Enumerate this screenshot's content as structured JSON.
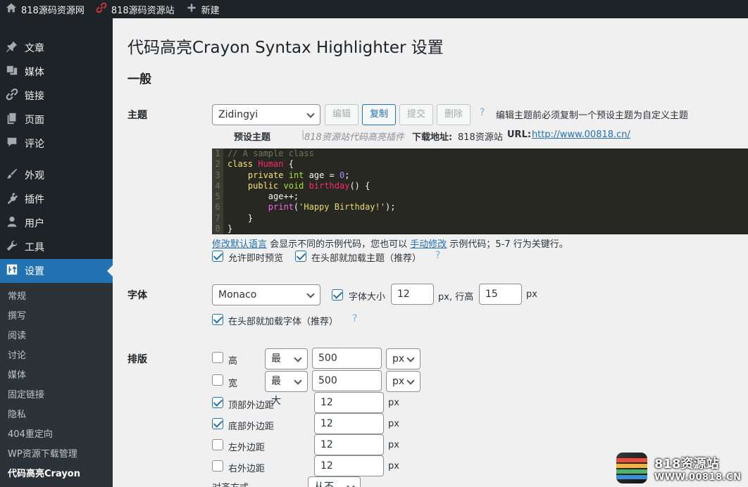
{
  "adminbar": {
    "home": "818源码资源网",
    "site": "818源码资源站",
    "new": "新建"
  },
  "sidebar": {
    "items": [
      {
        "label": "文章"
      },
      {
        "label": "媒体"
      },
      {
        "label": "链接"
      },
      {
        "label": "页面"
      },
      {
        "label": "评论"
      },
      {
        "label": "外观"
      },
      {
        "label": "插件"
      },
      {
        "label": "用户"
      },
      {
        "label": "工具"
      },
      {
        "label": "设置"
      }
    ],
    "submenu": [
      "常规",
      "撰写",
      "阅读",
      "讨论",
      "媒体",
      "固定链接",
      "隐私",
      "404重定向",
      "WP资源下载管理",
      "代码高亮Crayon"
    ]
  },
  "page": {
    "title": "代码高亮Crayon Syntax Highlighter 设置",
    "section": "一般"
  },
  "theme": {
    "label": "主题",
    "select": "Zidingyi",
    "edit": "编辑",
    "copy": "复制",
    "submit": "提交",
    "delete": "删除",
    "help": "?",
    "note": "编辑主题前必须复制一个预设主题为自定义主题",
    "preset_label": "预设主题",
    "preset_sep": "|",
    "preset_plugin": "818资源站代码高亮插件",
    "download_label": "下载地址:",
    "download_site": "818资源站",
    "url_label": "URL:",
    "url": "http://www.00818.cn/"
  },
  "code": {
    "lines": [
      "// A sample class",
      "class Human {",
      "    private int age = 0;",
      "    public void birthday() {",
      "        age++;",
      "        print('Happy Birthday!');",
      "    }",
      "}"
    ]
  },
  "info": {
    "link1": "修改默认语言",
    "text1": " 会显示不同的示例代码，您也可以 ",
    "link2": "手动修改",
    "text2": " 示例代码；5-7 行为关键行。",
    "preview": "允许即时预览",
    "load_theme": "在头部就加载主题（推荐）",
    "help": "?"
  },
  "font": {
    "label": "字体",
    "select": "Monaco",
    "size_label": "字体大小",
    "size": "12",
    "px": "px",
    "line_label": "px, 行高",
    "line": "15",
    "px2": "px",
    "load_font": "在头部就加载字体（推荐）",
    "help": "?"
  },
  "layout": {
    "label": "排版",
    "height_label": "高",
    "width_label": "宽",
    "max": "最大",
    "height_value": "500",
    "width_value": "500",
    "unit": "px",
    "rows": [
      {
        "label": "顶部外边距",
        "value": "12",
        "unit": "px",
        "checked": true
      },
      {
        "label": "底部外边距",
        "value": "12",
        "unit": "px",
        "checked": true
      },
      {
        "label": "左外边距",
        "value": "12",
        "unit": "px",
        "checked": false
      },
      {
        "label": "右外边距",
        "value": "12",
        "unit": "px",
        "checked": false
      }
    ],
    "align_label": "对齐方式",
    "align_value": "从不"
  },
  "watermark": {
    "line1": "818资源站",
    "line2": "WWW.00818.CN"
  }
}
